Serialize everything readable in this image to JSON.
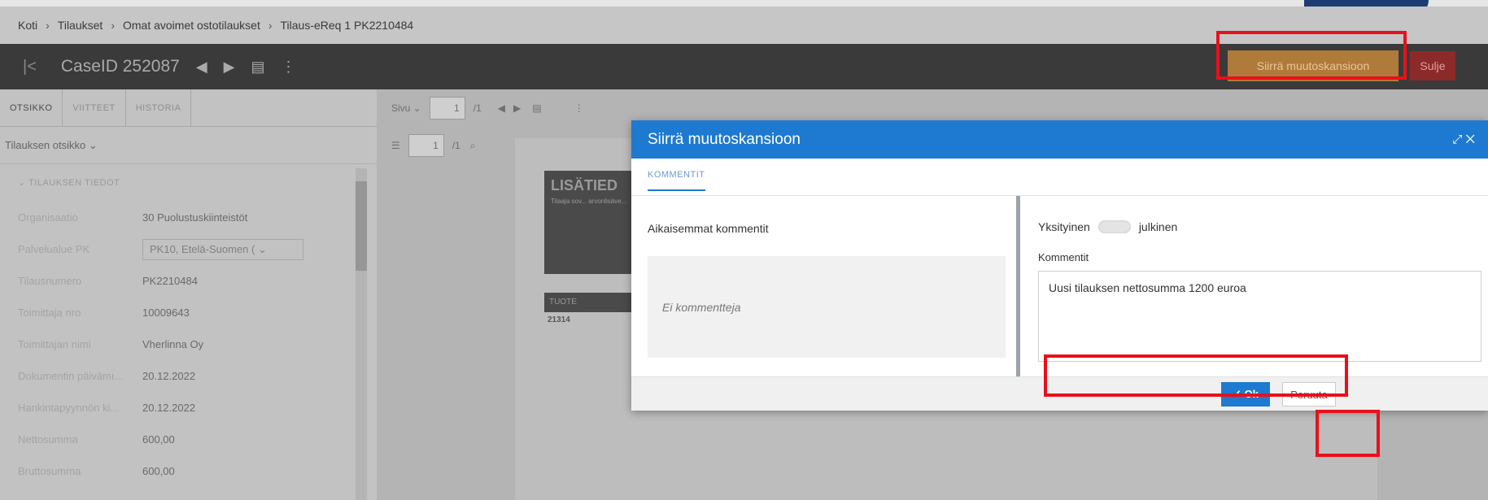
{
  "breadcrumb": [
    "Koti",
    "Tilaukset",
    "Omat avoimet ostotilaukset",
    "Tilaus-eReq 1 PK2210484"
  ],
  "breadcrumb_sep": "›",
  "casebar": {
    "back": "|<",
    "title": "CaseID 252087",
    "move_button": "Siirrä muutoskansioon",
    "close_button": "Sulje"
  },
  "left_tabs": [
    "OTSIKKO",
    "VIITTEET",
    "HISTORIA"
  ],
  "left_subhead": "Tilauksen otsikko ⌄",
  "section": "⌄ TILAUKSEN TIEDOT",
  "fields": [
    {
      "label": "Organisaatio",
      "value": "30 Puolustuskiinteistöt"
    },
    {
      "label": "Palvelualue PK",
      "value": "PK10, Etelä-Suomen ( ⌄"
    },
    {
      "label": "Tilausnumero",
      "value": "PK2210484"
    },
    {
      "label": "Toimittaja nro",
      "value": "10009643"
    },
    {
      "label": "Toimittajan nimi",
      "value": "Vherlinna Oy"
    },
    {
      "label": "Dokumentin päivämı...",
      "value": "20.12.2022"
    },
    {
      "label": "Hankintapyynnön ki...",
      "value": "20.12.2022"
    },
    {
      "label": "Nettosumma",
      "value": "600,00"
    },
    {
      "label": "Bruttosumma",
      "value": "600,00"
    }
  ],
  "viewer": {
    "page_label": "Sivu ⌄",
    "page_value": "1",
    "page_total": "/1",
    "page2_value": "1",
    "page2_total": "/1"
  },
  "doc": {
    "heading": "LISÄTIED",
    "sub": "Tilaaja sov... arvonlisäve...",
    "table_head": "TUOTE",
    "cell": "21314"
  },
  "modal": {
    "title": "Siirrä muutoskansioon",
    "controls": "⤢ ✕",
    "tab": "KOMMENTIT",
    "earlier_comments": "Aikaisemmat kommentit",
    "no_comments": "Ei kommentteja",
    "private": "Yksityinen",
    "public": "julkinen",
    "comments_label": "Kommentit",
    "comment_value": "Uusi tilauksen nettosumma 1200 euroa",
    "ok": "✓ Ok",
    "cancel": "Peruuta"
  },
  "colors": {
    "modal_header": "#1e7ad0",
    "highlight": "#e8101a",
    "move_button": "#b07a3a",
    "close_button": "#8c2a2a"
  }
}
